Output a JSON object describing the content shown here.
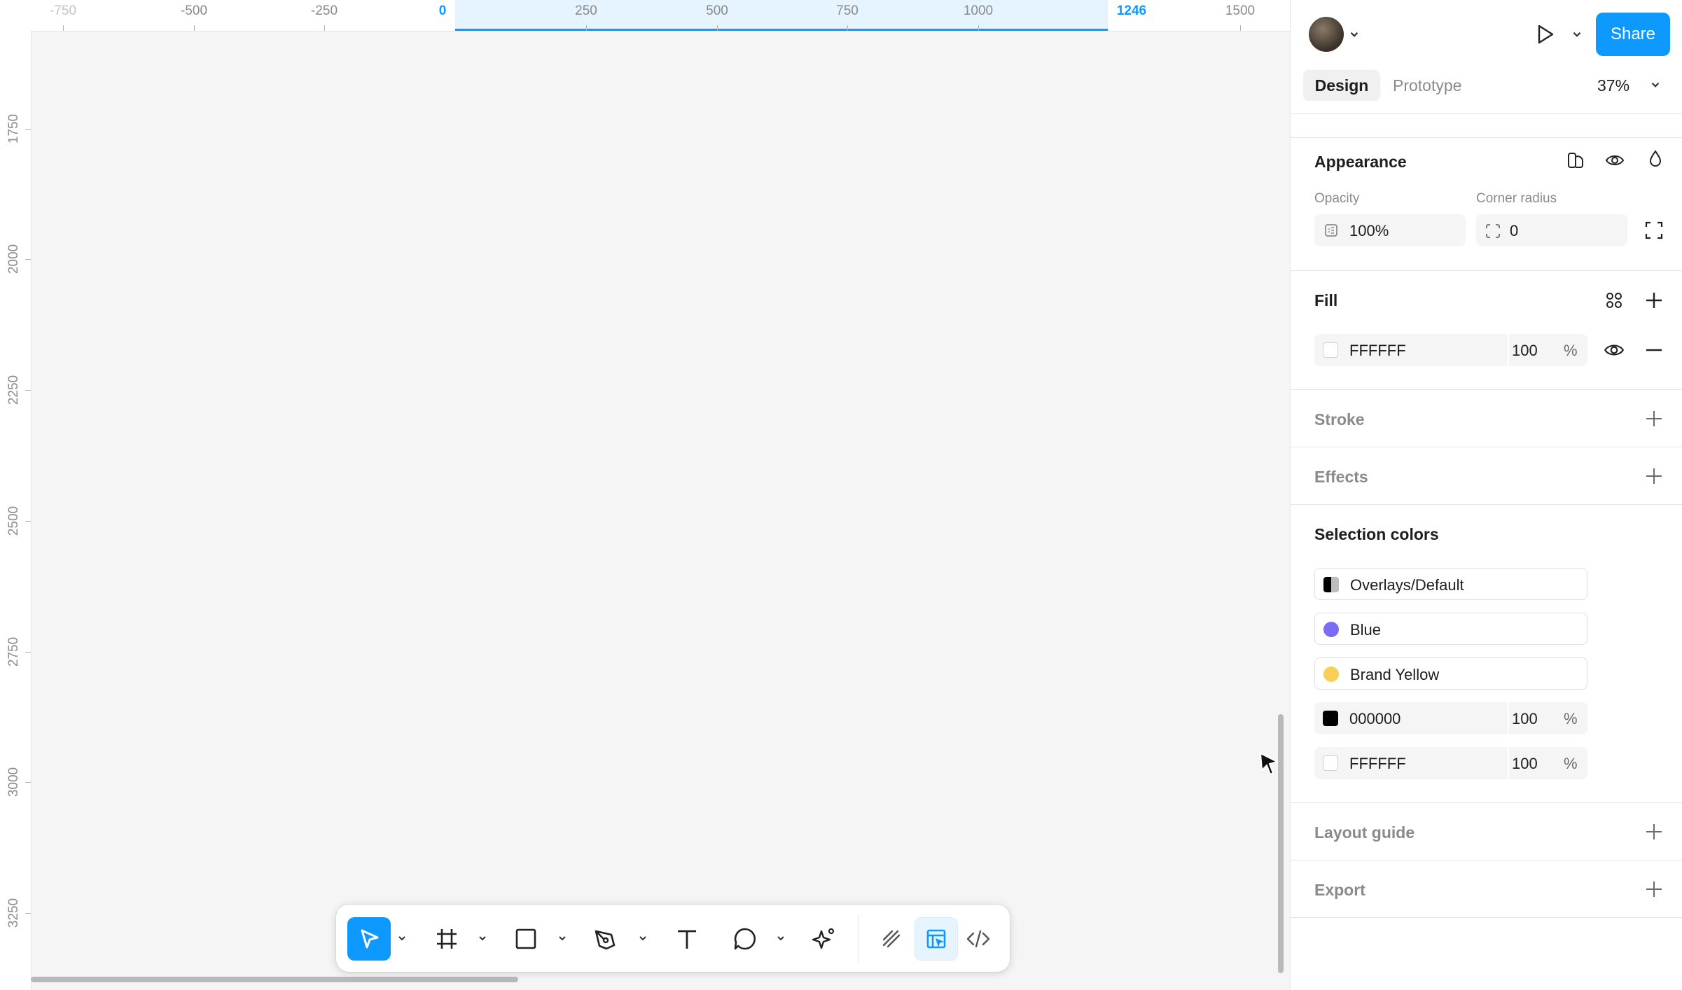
{
  "ruler": {
    "top_labels": [
      "-750",
      "-500",
      "-250",
      "0",
      "250",
      "500",
      "750",
      "1000",
      "1246",
      "1500"
    ],
    "left_labels": [
      "1750",
      "2000",
      "2250",
      "2500",
      "2750",
      "3000",
      "3250"
    ]
  },
  "toolbar": {
    "tools": [
      "move-tool",
      "frame-tool",
      "rectangle-tool",
      "pen-tool",
      "text-tool",
      "comment-tool",
      "actions-tool"
    ],
    "modes": [
      "draw-mode",
      "design-mode",
      "dev-mode"
    ],
    "active_tool": "move-tool",
    "active_mode": "design-mode"
  },
  "header": {
    "share_label": "Share",
    "zoom": "37%"
  },
  "tabs": {
    "design": "Design",
    "prototype": "Prototype"
  },
  "appearance": {
    "title": "Appearance",
    "opacity_label": "Opacity",
    "opacity_value": "100%",
    "radius_label": "Corner radius",
    "radius_value": "0"
  },
  "fill": {
    "title": "Fill",
    "hex": "FFFFFF",
    "opacity": "100",
    "pct": "%"
  },
  "sections": {
    "stroke": "Stroke",
    "effects": "Effects",
    "layout_guide": "Layout guide",
    "export": "Export"
  },
  "selection_colors": {
    "title": "Selection colors",
    "items": [
      {
        "label": "Overlays/Default",
        "color": "#000000"
      },
      {
        "label": "Blue",
        "color": "#7b6cf6"
      },
      {
        "label": "Brand Yellow",
        "color": "#f9cf58"
      },
      {
        "label": "000000",
        "opacity": "100",
        "pct": "%",
        "color": "#000000"
      },
      {
        "label": "FFFFFF",
        "opacity": "100",
        "pct": "%",
        "color": "#ffffff"
      }
    ]
  },
  "colors": {
    "accent": "#0d99ff",
    "canvas": "#f5f5f5"
  }
}
